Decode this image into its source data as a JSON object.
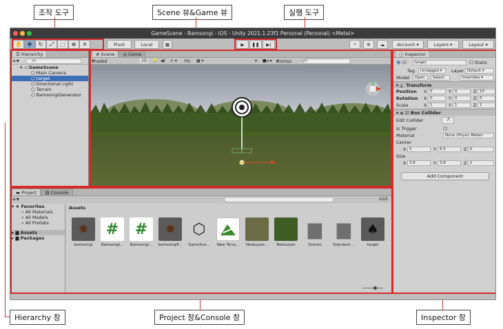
{
  "callouts": {
    "manip_tools": "조작 도구",
    "scene_game": "Scene 뷰&Game 뷰",
    "play_tools": "실행 도구",
    "hierarchy": "Hierarchy 창",
    "project_console": "Project 창&Console 창",
    "inspector": "Inspector 창"
  },
  "window": {
    "title": "GameScene - Bamsongi - iOS - Unity 2021.1.23f1 Personal (Personal) <Metal>"
  },
  "toolbar": {
    "pivot": "Pivot",
    "local": "Local",
    "account": "Account",
    "layers": "Layers",
    "layout": "Layout",
    "tools": [
      "hand-tool",
      "move-tool",
      "rotate-tool",
      "scale-tool",
      "rect-tool",
      "transform-tool",
      "custom-tool"
    ]
  },
  "hierarchy": {
    "tab": "Hierarchy",
    "search_placeholder": "All",
    "scene": "GameScene",
    "items": [
      "Main Camera",
      "target",
      "Directional Light",
      "Terrain",
      "BamsongiGenerator"
    ],
    "selected_index": 1
  },
  "scene_view": {
    "tabs": [
      "Scene",
      "Game"
    ],
    "shading": "Shaded",
    "mode_2d": "2D",
    "gizmos": "Gizmos",
    "search_placeholder": "All",
    "fx_count": "0"
  },
  "project": {
    "tabs": [
      "Project",
      "Console"
    ],
    "favorites_label": "Favorites",
    "favorites": [
      "All Materials",
      "All Models",
      "All Prefabs"
    ],
    "folders": [
      "Assets",
      "Packages"
    ],
    "breadcrumb": "Assets",
    "count": "10",
    "assets": [
      {
        "name": "bamsongi",
        "kind": "chestnut-thumb"
      },
      {
        "name": "Bamsongi...",
        "kind": "script-thumb"
      },
      {
        "name": "Bamsongi...",
        "kind": "script-thumb"
      },
      {
        "name": "bamsongiP...",
        "kind": "chestnut-thumb"
      },
      {
        "name": "GameSce...",
        "kind": "unity-scene-thumb"
      },
      {
        "name": "New Terra...",
        "kind": "terrain-thumb"
      },
      {
        "name": "NewLayer...",
        "kind": "grass-texture-thumb"
      },
      {
        "name": "NewLayer",
        "kind": "grass-layer-thumb"
      },
      {
        "name": "Scenes",
        "kind": "folder-thumb"
      },
      {
        "name": "Standard ...",
        "kind": "folder-thumb"
      },
      {
        "name": "target",
        "kind": "target-thumb"
      }
    ]
  },
  "inspector": {
    "tab": "Inspector",
    "object_name": "target",
    "static_label": "Static",
    "tag_label": "Tag",
    "tag_value": "Untagged",
    "layer_label": "Layer",
    "layer_value": "Default",
    "model_label": "Model",
    "open": "Open",
    "select": "Select",
    "overrides": "Overrides",
    "transform_title": "Transform",
    "position_label": "Position",
    "pos": [
      "0",
      "0",
      "10"
    ],
    "rotation_label": "Rotation",
    "rot": [
      "0",
      "0",
      "0"
    ],
    "scale_label": "Scale",
    "scl": [
      "1",
      "1",
      "1"
    ],
    "box_collider_title": "Box Collider",
    "edit_collider": "Edit Collider",
    "is_trigger": "Is Trigger",
    "material_label": "Material",
    "material_value": "None (Physic Materi",
    "center_label": "Center",
    "center": [
      "0",
      "6.5",
      "0"
    ],
    "size_label": "Size",
    "size": [
      "3.8",
      "3.8",
      "1"
    ],
    "add_component": "Add Component"
  },
  "colors": {
    "accent": "#d42a2a",
    "selection": "#3d6fb5"
  }
}
